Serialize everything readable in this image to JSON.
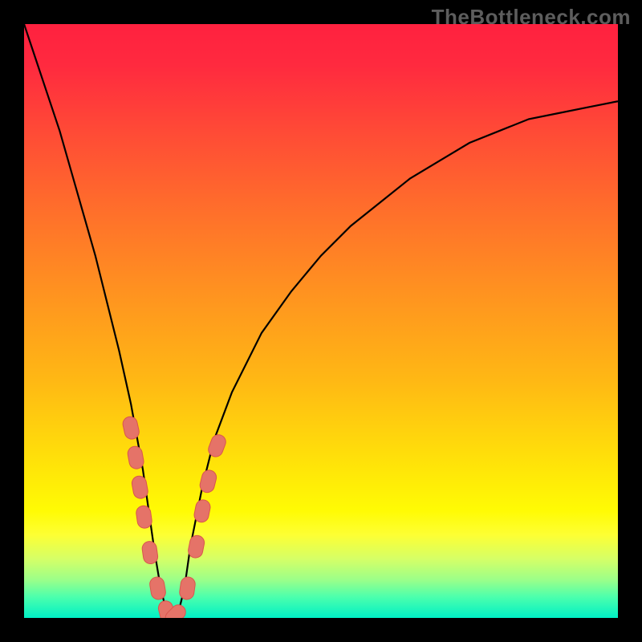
{
  "watermark": "TheBottleneck.com",
  "colors": {
    "frame_bg": "#000000",
    "gradient_stops": [
      {
        "offset": 0.0,
        "color": "#ff213f"
      },
      {
        "offset": 0.07,
        "color": "#ff2a3f"
      },
      {
        "offset": 0.18,
        "color": "#ff4a36"
      },
      {
        "offset": 0.3,
        "color": "#ff6b2c"
      },
      {
        "offset": 0.45,
        "color": "#ff9220"
      },
      {
        "offset": 0.6,
        "color": "#ffb814"
      },
      {
        "offset": 0.75,
        "color": "#ffe608"
      },
      {
        "offset": 0.82,
        "color": "#fffb04"
      },
      {
        "offset": 0.86,
        "color": "#fdff33"
      },
      {
        "offset": 0.9,
        "color": "#d6ff66"
      },
      {
        "offset": 0.935,
        "color": "#9dff88"
      },
      {
        "offset": 0.965,
        "color": "#4bffad"
      },
      {
        "offset": 1.0,
        "color": "#00f0c5"
      }
    ],
    "curve_stroke": "#000000",
    "marker_fill": "#e57368",
    "marker_stroke": "#d9564d"
  },
  "chart_data": {
    "type": "line",
    "title": "",
    "xlabel": "",
    "ylabel": "",
    "xlim": [
      0,
      100
    ],
    "ylim": [
      0,
      100
    ],
    "note": "V-shaped bottleneck curve. y-axis is inverted visually (0 at bottom = green/good, 100 at top = red/bad). x is a parameter sweep; the minimum of the curve is the balanced configuration.",
    "series": [
      {
        "name": "bottleneck-curve",
        "x": [
          0,
          2,
          4,
          6,
          8,
          10,
          12,
          14,
          16,
          18,
          20,
          21,
          22,
          23,
          24,
          25,
          26,
          27,
          28,
          30,
          32,
          35,
          40,
          45,
          50,
          55,
          60,
          65,
          70,
          75,
          80,
          85,
          90,
          95,
          100
        ],
        "y": [
          100,
          94,
          88,
          82,
          75,
          68,
          61,
          53,
          45,
          36,
          25,
          18,
          11,
          5,
          1,
          0,
          1,
          5,
          12,
          22,
          30,
          38,
          48,
          55,
          61,
          66,
          70,
          74,
          77,
          80,
          82,
          84,
          85,
          86,
          87
        ]
      }
    ],
    "markers": {
      "name": "highlight-segments",
      "note": "Short stadium-shaped markers overlaid on the curve near the trough (both descending and ascending legs).",
      "points": [
        {
          "x": 18.0,
          "y": 32
        },
        {
          "x": 18.8,
          "y": 27
        },
        {
          "x": 19.5,
          "y": 22
        },
        {
          "x": 20.2,
          "y": 17
        },
        {
          "x": 21.2,
          "y": 11
        },
        {
          "x": 22.5,
          "y": 5
        },
        {
          "x": 24.0,
          "y": 1
        },
        {
          "x": 25.5,
          "y": 0.5
        },
        {
          "x": 27.5,
          "y": 5
        },
        {
          "x": 29.0,
          "y": 12
        },
        {
          "x": 30.0,
          "y": 18
        },
        {
          "x": 31.0,
          "y": 23
        },
        {
          "x": 32.5,
          "y": 29
        }
      ]
    }
  }
}
